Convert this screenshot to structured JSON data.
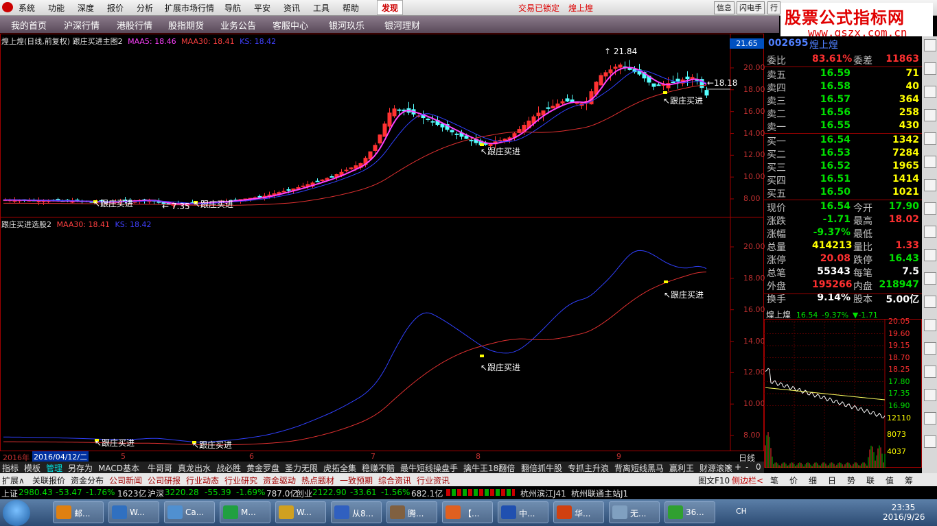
{
  "menu": {
    "items": [
      "系统",
      "功能",
      "深度",
      "报价",
      "分析",
      "扩展市场行情",
      "导航",
      "平安",
      "资讯",
      "工具",
      "帮助"
    ],
    "active": "发现",
    "status1": "交易已锁定",
    "status2": "煌上煌",
    "right_buttons": [
      "信息",
      "闪电手",
      "行"
    ]
  },
  "nav": {
    "items": [
      "我的首页",
      "沪深行情",
      "港股行情",
      "股指期货",
      "业务公告",
      "客服中心",
      "银河玖乐",
      "银河理财"
    ]
  },
  "logo": {
    "line1": "股票公式指标网",
    "line2": "www.gszx.com.cn"
  },
  "main_chart": {
    "title": "煌上煌(日线,前复权) 跟庄买进主图2",
    "maa5": "MAA5: 18.46",
    "maa30": "MAA30: 18.41",
    "ks": "KS: 18.42",
    "price_top": "21.65",
    "high_label": "21.84",
    "low_label": "7.35",
    "last_label": "18.18",
    "signal": "跟庄买进",
    "y_ticks": [
      "20.00",
      "18.00",
      "16.00",
      "14.00",
      "12.00",
      "10.00",
      "8.00"
    ]
  },
  "sub_chart": {
    "title": "跟庄买进选股2",
    "maa30": "MAA30: 18.41",
    "ks": "KS: 18.42",
    "signal": "跟庄买进",
    "y_ticks": [
      "20.00",
      "18.00",
      "16.00",
      "14.00",
      "12.00",
      "10.00",
      "8.00"
    ]
  },
  "x_axis": {
    "year": "2016年",
    "cursor_date": "2016/04/12/二",
    "months": [
      "5",
      "6",
      "7",
      "8",
      "9"
    ],
    "period": "日线"
  },
  "quote": {
    "code": "002695",
    "name": "煌上煌",
    "weibi_label": "委比",
    "weibi": "83.61%",
    "weicha_label": "委差",
    "weicha": "11863",
    "asks": [
      {
        "label": "卖五",
        "price": "16.59",
        "vol": "71"
      },
      {
        "label": "卖四",
        "price": "16.58",
        "vol": "40"
      },
      {
        "label": "卖三",
        "price": "16.57",
        "vol": "364"
      },
      {
        "label": "卖二",
        "price": "16.56",
        "vol": "258"
      },
      {
        "label": "卖一",
        "price": "16.55",
        "vol": "430"
      }
    ],
    "bids": [
      {
        "label": "买一",
        "price": "16.54",
        "vol": "1342"
      },
      {
        "label": "买二",
        "price": "16.53",
        "vol": "7284"
      },
      {
        "label": "买三",
        "price": "16.52",
        "vol": "1965"
      },
      {
        "label": "买四",
        "price": "16.51",
        "vol": "1414"
      },
      {
        "label": "买五",
        "price": "16.50",
        "vol": "1021"
      }
    ],
    "stats": [
      {
        "l1": "现价",
        "v1": "16.54",
        "c1": "green",
        "l2": "今开",
        "v2": "17.90",
        "c2": "green"
      },
      {
        "l1": "涨跌",
        "v1": "-1.71",
        "c1": "green",
        "l2": "最高",
        "v2": "18.02",
        "c2": "red"
      },
      {
        "l1": "涨幅",
        "v1": "-9.37%",
        "c1": "green",
        "l2": "最低",
        "v2": "",
        "c2": "green"
      },
      {
        "l1": "总量",
        "v1": "414213",
        "c1": "yellow",
        "l2": "量比",
        "v2": "1.33",
        "c2": "red"
      },
      {
        "l1": "涨停",
        "v1": "20.08",
        "c1": "red",
        "l2": "跌停",
        "v2": "16.43",
        "c2": "green"
      },
      {
        "l1": "总笔",
        "v1": "55343",
        "c1": "white",
        "l2": "每笔",
        "v2": "7.5",
        "c2": "white"
      },
      {
        "l1": "外盘",
        "v1": "195266",
        "c1": "red",
        "l2": "内盘",
        "v2": "218947",
        "c2": "green"
      },
      {
        "l1": "换手",
        "v1": "9.14%",
        "c1": "white",
        "l2": "股本",
        "v2": "5.00亿",
        "c2": "white"
      }
    ]
  },
  "mini": {
    "name": "煌上煌",
    "price": "16.54",
    "pct": "-9.37%",
    "chg": "▼-1.71",
    "y_ticks": [
      "20.05",
      "19.60",
      "19.15",
      "18.70",
      "18.25",
      "17.80",
      "17.35",
      "16.90"
    ],
    "vol_ticks": [
      "12110",
      "8073",
      "4037"
    ]
  },
  "formula_tabs": [
    "指标",
    "模板",
    "管理",
    "另存为",
    "MACD基本",
    "牛哥哥",
    "真龙出水",
    "战必胜",
    "黄金罗盘",
    "圣力无限",
    "虎拓全集",
    "稳赚不赔",
    "最牛短线操盘手",
    "擒牛王18翻倍",
    "翻倍抓牛股",
    "专抓主升浪",
    "背离短线黑马",
    "赢利王",
    "财源滚滚"
  ],
  "bottom_tabs": [
    "扩展∧",
    "关联报价",
    "资金分布",
    "公司新闻",
    "公司研报",
    "行业动态",
    "行业研究",
    "资金驱动",
    "热点题材",
    "一致预期",
    "综合资讯",
    "行业资讯"
  ],
  "bottom_right": [
    "图文F10",
    "侧边栏<",
    "笔",
    "价",
    "细",
    "日",
    "势",
    "联",
    "值",
    "筹"
  ],
  "indices": {
    "sh": "上证",
    "sh_val": "2980.43",
    "sh_chg": "-53.47",
    "sh_pct": "-1.76%",
    "sh_amt": "1623亿",
    "hs": "沪深",
    "hs_val": "3220.28",
    "hs_chg": "-55.39",
    "hs_pct": "-1.69%",
    "hs_amt": "787.0亿",
    "cy": "创业",
    "cy_val": "2122.90",
    "cy_chg": "-33.61",
    "cy_pct": "-1.56%",
    "cy_amt": "682.1亿",
    "branch1": "杭州滨江J41",
    "branch2": "杭州联通主站J1"
  },
  "taskbar": {
    "tasks": [
      "邮...",
      "W...",
      "Ca...",
      "M...",
      "W...",
      "从8...",
      "腾...",
      "【...",
      "中...",
      "华...",
      "无...",
      "36..."
    ],
    "lang": "CH",
    "time": "23:35",
    "date": "2016/9/26"
  }
}
